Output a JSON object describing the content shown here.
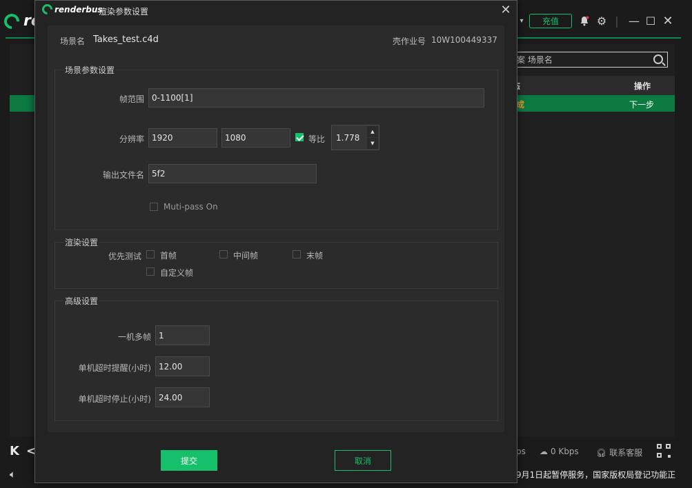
{
  "background": {
    "logo_text": "re",
    "recharge_label": "充值",
    "search_placeholder": "案 场景名",
    "col_status": "态",
    "col_actions": "操作",
    "row_status": "成",
    "row_action": "下一步",
    "stat_partial": "ps",
    "stat_download": "0 Kbps",
    "stat_support": "联系客服",
    "notice_text": "9月1日起暂停服务，国家版权局登记功能正",
    "colors": {
      "accent": "#17c06a",
      "row_highlight": "#0d7a42",
      "status_text": "#e39c2a"
    }
  },
  "dialog": {
    "brand": "renderbus",
    "title": "渲染参数设置",
    "scene_label": "场景名",
    "scene_value": "Takes_test.c4d",
    "job_label": "壳作业号",
    "job_value": "10W100449337",
    "scene_params": {
      "legend": "场景参数设置",
      "frame_range_label": "帧范围",
      "frame_range_value": "0-1100[1]",
      "resolution_label": "分辨率",
      "width_value": "1920",
      "height_value": "1080",
      "ratio_label": "等比",
      "ratio_checked": true,
      "ratio_value": "1.778",
      "output_label": "输出文件名",
      "output_value": "5f2",
      "multipass_label": "Muti-pass On",
      "multipass_checked": false
    },
    "render_settings": {
      "legend": "渲染设置",
      "priority_label": "优先测试",
      "first_frame": "首帧",
      "middle_frame": "中间帧",
      "last_frame": "末帧",
      "custom_frame": "自定义帧"
    },
    "advanced": {
      "legend": "高级设置",
      "multi_frame_label": "一机多帧",
      "multi_frame_value": "1",
      "timeout_warn_label": "单机超时提醒(小时)",
      "timeout_warn_value": "12.00",
      "timeout_stop_label": "单机超时停止(小时)",
      "timeout_stop_value": "24.00"
    },
    "submit_label": "提交",
    "cancel_label": "取消"
  }
}
